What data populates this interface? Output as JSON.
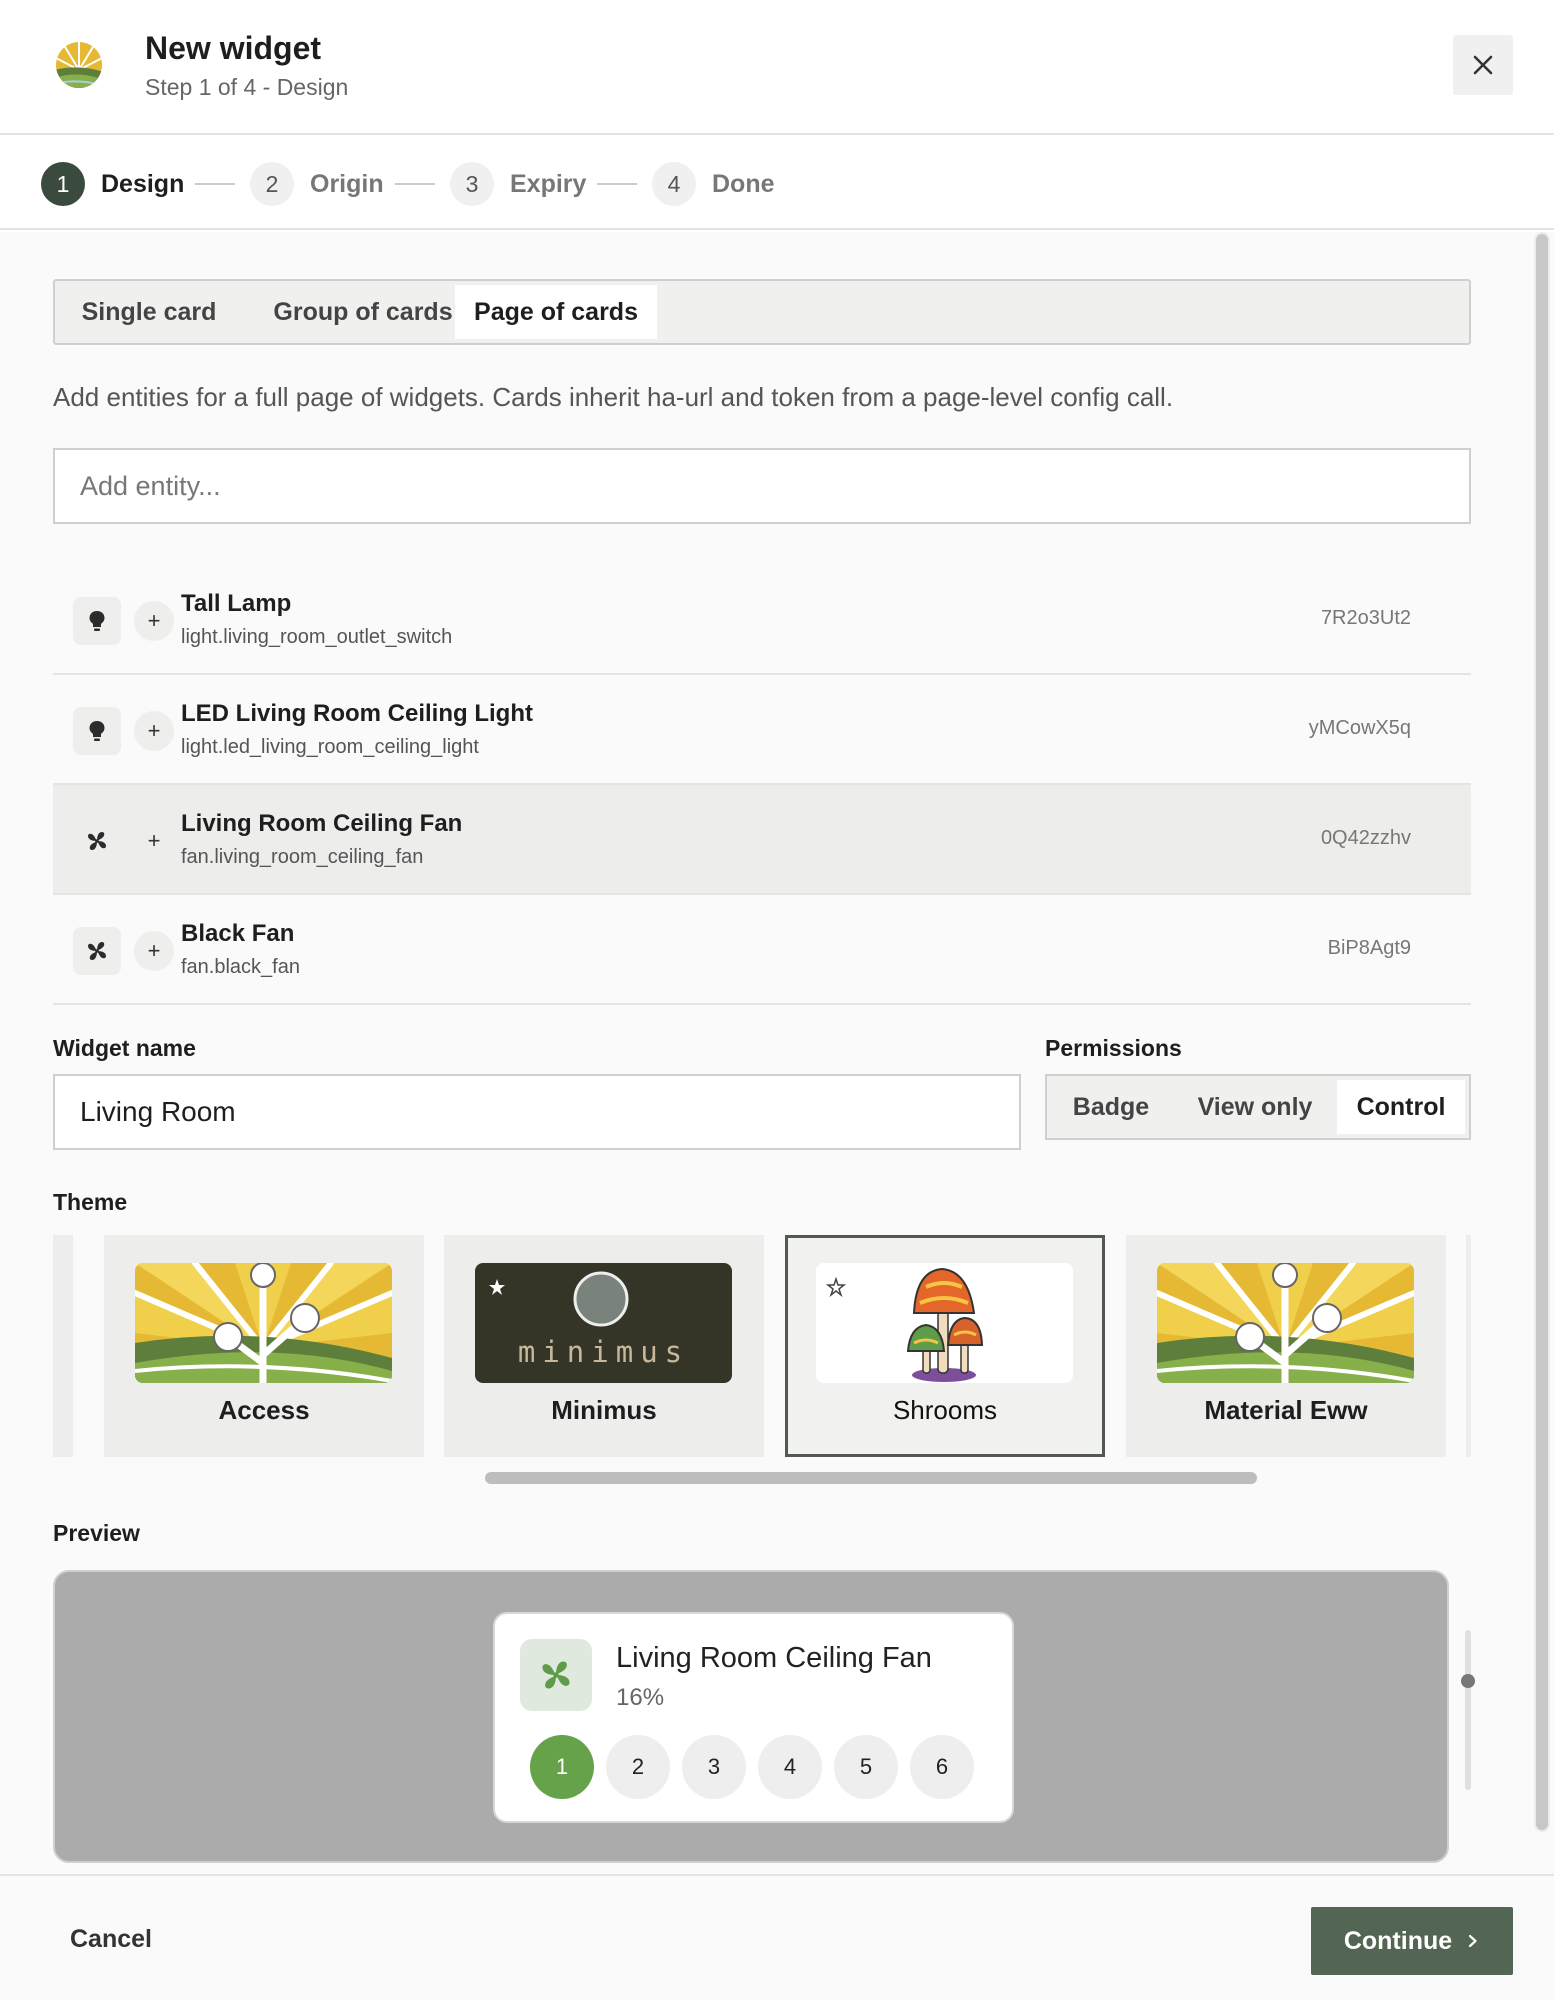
{
  "header": {
    "title": "New widget",
    "subtitle": "Step 1 of 4 - Design"
  },
  "stepper": {
    "steps": [
      {
        "number": "1",
        "label": "Design",
        "active": true
      },
      {
        "number": "2",
        "label": "Origin",
        "active": false
      },
      {
        "number": "3",
        "label": "Expiry",
        "active": false
      },
      {
        "number": "4",
        "label": "Done",
        "active": false
      }
    ]
  },
  "mode_tabs": {
    "items": [
      {
        "label": "Single card"
      },
      {
        "label": "Group of cards"
      },
      {
        "label": "Page of cards"
      }
    ],
    "selected": "Page of cards"
  },
  "help_text": "Add entities for a full page of widgets. Cards inherit ha-url and token from a page-level config call.",
  "add_entity": {
    "placeholder": "Add entity...",
    "value": ""
  },
  "entities": [
    {
      "name": "Tall Lamp",
      "entity_id": "light.living_room_outlet_switch",
      "token": "7R2o3Ut2",
      "icon": "lightbulb-icon",
      "add_label": "+"
    },
    {
      "name": "LED Living Room Ceiling Light",
      "entity_id": "light.led_living_room_ceiling_light",
      "token": "yMCowX5q",
      "icon": "lightbulb-icon",
      "add_label": "+"
    },
    {
      "name": "Living Room Ceiling Fan",
      "entity_id": "fan.living_room_ceiling_fan",
      "token": "0Q42zzhv",
      "icon": "fan-icon",
      "add_label": "+"
    },
    {
      "name": "Black Fan",
      "entity_id": "fan.black_fan",
      "token": "BiP8Agt9",
      "icon": "fan-icon",
      "add_label": "+"
    }
  ],
  "widget_name": {
    "label": "Widget name",
    "value": "Living Room"
  },
  "permissions": {
    "label": "Permissions",
    "options": [
      {
        "label": "Badge"
      },
      {
        "label": "View only"
      },
      {
        "label": "Control"
      }
    ],
    "selected": "Control"
  },
  "theme": {
    "label": "Theme",
    "options": [
      {
        "name": "Access",
        "thumbnail": "sunrise-fields-image"
      },
      {
        "name": "Minimus",
        "thumbnail": "minimus-dark-image",
        "thumbnail_text": "minimus",
        "starred": true
      },
      {
        "name": "Shrooms",
        "thumbnail": "mushrooms-image",
        "starred": true
      },
      {
        "name": "Material Eww",
        "thumbnail": "sunrise-fields-image"
      }
    ],
    "selected": "Shrooms"
  },
  "preview": {
    "label": "Preview",
    "card": {
      "name": "Living Room Ceiling Fan",
      "value": "16%",
      "icon": "fan-icon",
      "speeds": [
        "1",
        "2",
        "3",
        "4",
        "5",
        "6"
      ],
      "selected_speed": "1"
    }
  },
  "footer": {
    "cancel_label": "Cancel",
    "continue_label": "Continue"
  },
  "colors": {
    "accent_dark": "#3b4a3f",
    "continue": "#536553",
    "speed_active": "#66a24a",
    "preview_bg": "#ababab"
  }
}
